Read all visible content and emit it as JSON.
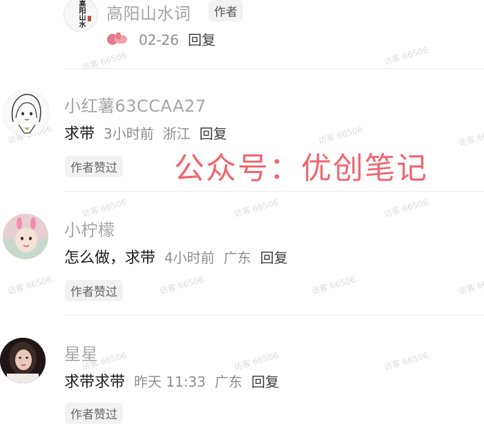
{
  "comments": [
    {
      "name": "高阳山水词",
      "author_badge": "作者",
      "date": "02-26",
      "reply_label": "回复"
    },
    {
      "name": "小红薯63CCAA27",
      "text": "求带",
      "time": "3小时前",
      "location": "浙江",
      "reply_label": "回复",
      "liked_badge": "作者赞过"
    },
    {
      "name": "小柠檬",
      "text": "怎么做，求带",
      "time": "4小时前",
      "location": "广东",
      "reply_label": "回复",
      "liked_badge": "作者赞过"
    },
    {
      "name": "星星",
      "text": "求带求带",
      "time": "昨天 11:33",
      "location": "广东",
      "reply_label": "回复",
      "liked_badge": "作者赞过"
    }
  ],
  "avatar_text": "高阳山水",
  "overlay_text": "公众号：优创笔记",
  "watermark_text": "访客 66506"
}
